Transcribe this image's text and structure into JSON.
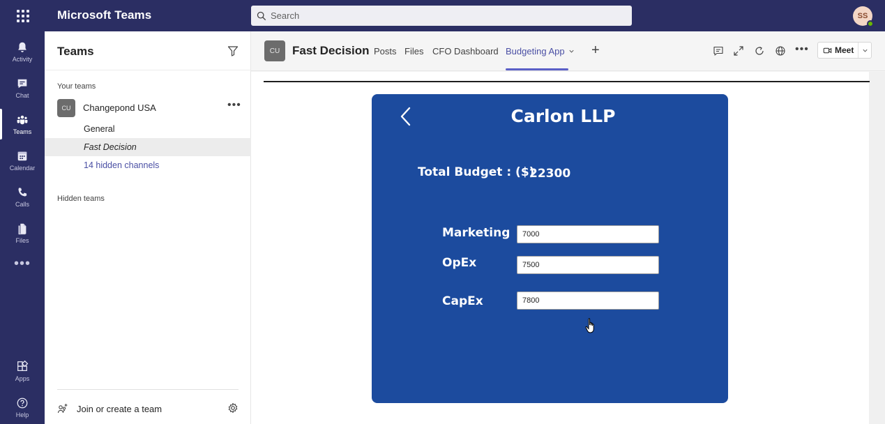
{
  "topbar": {
    "app_title": "Microsoft Teams",
    "search_placeholder": "Search",
    "avatar_initials": "SS"
  },
  "rail": {
    "items": [
      {
        "label": "Activity",
        "icon": "bell-icon"
      },
      {
        "label": "Chat",
        "icon": "chat-icon"
      },
      {
        "label": "Teams",
        "icon": "teams-icon"
      },
      {
        "label": "Calendar",
        "icon": "calendar-icon"
      },
      {
        "label": "Calls",
        "icon": "phone-icon"
      },
      {
        "label": "Files",
        "icon": "file-icon"
      },
      {
        "label": "Apps",
        "icon": "apps-icon"
      },
      {
        "label": "Help",
        "icon": "help-icon"
      }
    ],
    "more": "•••"
  },
  "panel": {
    "title": "Teams",
    "your_teams_label": "Your teams",
    "team": {
      "badge": "CU",
      "name": "Changepond USA",
      "more": "•••"
    },
    "channels": [
      {
        "label": "General"
      },
      {
        "label": "Fast Decision"
      },
      {
        "label": "14 hidden channels"
      }
    ],
    "hidden_teams_label": "Hidden teams",
    "join_label": "Join or create a team"
  },
  "channel_header": {
    "badge": "CU",
    "title": "Fast Decision",
    "tabs": [
      {
        "label": "Posts"
      },
      {
        "label": "Files"
      },
      {
        "label": "CFO Dashboard"
      },
      {
        "label": "Budgeting App"
      }
    ],
    "active_tab": "Budgeting App",
    "plus": "+",
    "more": "•••",
    "meet_label": "Meet"
  },
  "app": {
    "company": "Carlon LLP",
    "total_budget_label": "Total Budget : ($)",
    "total_budget_value": "22300",
    "fields": [
      {
        "label": "Marketing",
        "value": "7000"
      },
      {
        "label": "OpEx",
        "value": "7500"
      },
      {
        "label": "CapEx",
        "value": "7800"
      }
    ]
  },
  "colors": {
    "rail": "#2b2e63",
    "accent": "#5b5fc7",
    "app_card": "#1c4b9e"
  }
}
